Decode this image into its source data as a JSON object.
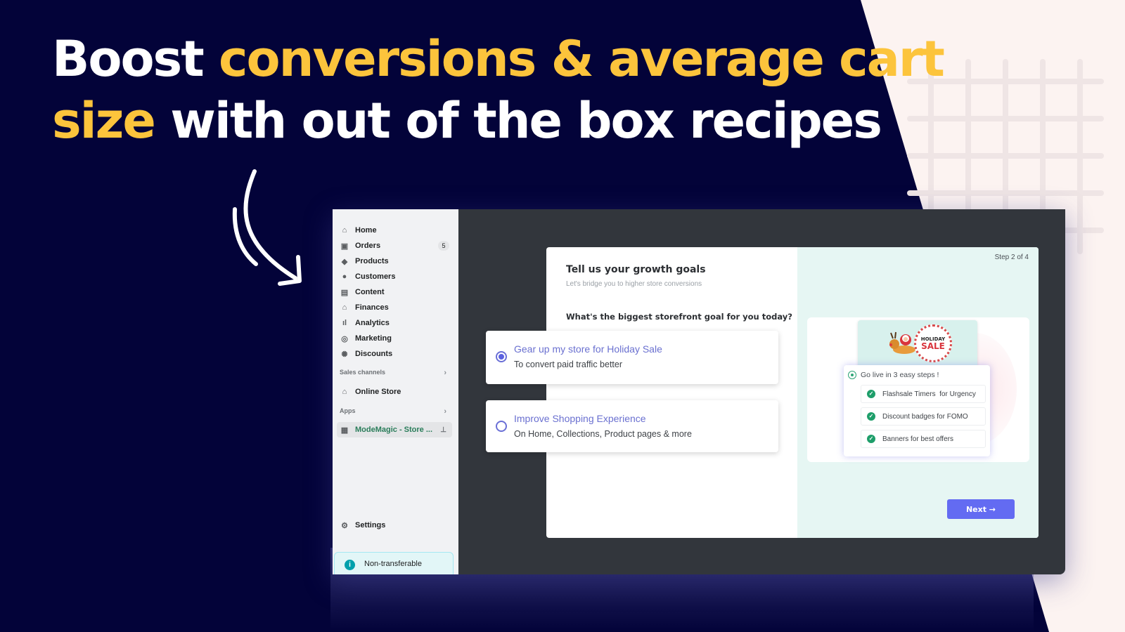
{
  "headline": {
    "line1_white": "Boost ",
    "line1_yellow": "conversions & average cart",
    "line2_yellow": "size",
    "line2_white": " with out of the box recipes"
  },
  "colors": {
    "background_dark": "#030339",
    "background_light": "#fcf3f1",
    "highlight": "#fcc43c",
    "accent": "#636bf2",
    "success": "#1e9e6a"
  },
  "sidebar": {
    "items": [
      {
        "label": "Home",
        "icon": "home-icon"
      },
      {
        "label": "Orders",
        "icon": "inbox-icon",
        "badge": "5"
      },
      {
        "label": "Products",
        "icon": "tag-icon"
      },
      {
        "label": "Customers",
        "icon": "person-icon"
      },
      {
        "label": "Content",
        "icon": "image-icon"
      },
      {
        "label": "Finances",
        "icon": "bank-icon"
      },
      {
        "label": "Analytics",
        "icon": "bar-chart-icon"
      },
      {
        "label": "Marketing",
        "icon": "target-icon"
      },
      {
        "label": "Discounts",
        "icon": "discount-icon"
      }
    ],
    "sales_channels_label": "Sales channels",
    "online_store_label": "Online Store",
    "apps_label": "Apps",
    "app_item_label": "ModeMagic - Store ...",
    "settings_label": "Settings",
    "notice_label": "Non-transferable"
  },
  "modal": {
    "step": "Step 2 of 4",
    "title": "Tell us your growth goals",
    "subtitle": "Let's bridge you to higher store conversions",
    "question": "What's the biggest storefront goal for you today?",
    "options": [
      {
        "title": "Gear up my store for Holiday Sale",
        "subtitle": "To convert paid traffic better",
        "selected": true
      },
      {
        "title": "Improve Shopping Experience",
        "subtitle": "On Home, Collections, Product pages & more",
        "selected": false
      }
    ],
    "preview": {
      "banner_line1": "HOLIDAY",
      "banner_line2": "SALE",
      "steps_heading": "Go live in 3 easy steps !",
      "steps": [
        "Flashsale Timers  for Urgency",
        "Discount badges for FOMO",
        "Banners for best offers"
      ]
    },
    "next_label": "Next →"
  }
}
